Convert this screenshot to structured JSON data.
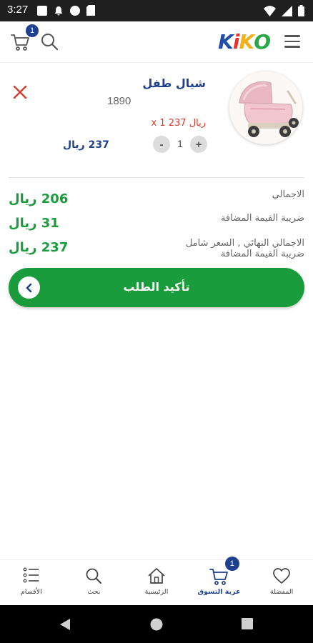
{
  "status_bar": {
    "time": "3:27"
  },
  "header": {
    "logo_text": [
      "K",
      "i",
      "K",
      "O"
    ],
    "cart_badge": "1"
  },
  "cart_item": {
    "name": "شيال طفل",
    "sku": "1890",
    "unit_price": "ريال 237 x 1",
    "line_total": "237 ريال",
    "quantity": "1",
    "minus_label": "-",
    "plus_label": "+"
  },
  "totals": {
    "subtotal_label": "الاجمالي",
    "subtotal_amount": "206 ريال",
    "vat_label": "ضريبة القيمة المضافة",
    "vat_amount": "31 ريال",
    "grand_label_line1": "الاجمالي النهائي , السعر شامل",
    "grand_label_line2": "ضريبة القيمة المضافة",
    "grand_amount": "237 ريال"
  },
  "confirm_button": {
    "label": "تأكيد الطلب"
  },
  "bottom_nav": {
    "favorites": "المفضلة",
    "cart": "عربة التسوق",
    "cart_badge": "1",
    "home": "الرئيسية",
    "search": "بحث",
    "categories": "الأقسام"
  },
  "colors": {
    "brand_blue": "#1f3f8f",
    "accent_green": "#1a9c3d",
    "price_red": "#d93a2b"
  }
}
